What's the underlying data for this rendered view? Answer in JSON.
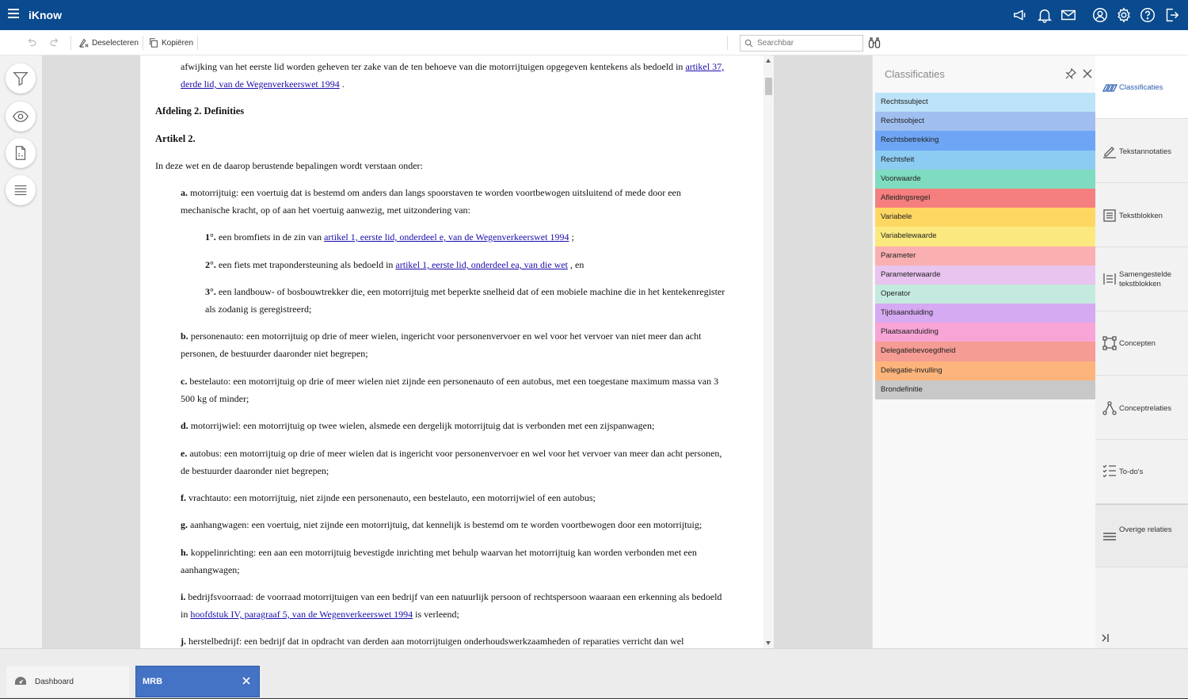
{
  "app": {
    "title": "iKnow"
  },
  "toolbar": {
    "deselect_label": "Deselecteren",
    "copy_label": "Kopiëren",
    "search_placeholder": "Searchbar"
  },
  "document": {
    "p0_text": "afwijking van het eerste lid worden geheven ter zake van de ten behoeve van die motorrijtuigen opgegeven kentekens als bedoeld in ",
    "p0_link1": "artikel 37,",
    "p0_link2": "derde lid, van de Wegenverkeerswet 1994",
    "p0_end": " .",
    "h_afdeling": "Afdeling 2. Definities",
    "h_artikel": "Artikel 2.",
    "intro": "In deze wet en de daarop berustende bepalingen wordt verstaan onder:",
    "a_letter": "a.",
    "a_text1": " motorrijtuig: een voertuig dat is bestemd om anders dan langs spoorstaven te worden voortbewogen uitsluitend of mede door een",
    "a_text2": "mechanische kracht, op of aan het voertuig aanwezig, met uitzondering van:",
    "a1_num": "1°.",
    "a1_text": " een bromfiets in de zin van ",
    "a1_link": "artikel 1, eerste lid, onderdeel e, van de Wegenverkeerswet 1994",
    "a1_end": " ;",
    "a2_num": "2°.",
    "a2_text": " een fiets met trapondersteuning als bedoeld in ",
    "a2_link": "artikel 1, eerste lid, onderdeel ea, van die wet",
    "a2_end": " , en",
    "a3_num": "3°.",
    "a3_text1": " een landbouw- of bosbouwtrekker die, een motorrijtuig met beperkte snelheid dat of een mobiele machine die in het kentekenregister",
    "a3_text2": "als zodanig is geregistreerd;",
    "b_letter": "b.",
    "b_text1": " personenauto: een motorrijtuig op drie of meer wielen, ingericht voor personenvervoer en wel voor het vervoer van niet meer dan acht",
    "b_text2": "personen, de bestuurder daaronder niet begrepen;",
    "c_letter": "c.",
    "c_text1": " bestelauto: een motorrijtuig op drie of meer wielen niet zijnde een personenauto of een autobus, met een toegestane maximum massa van 3",
    "c_text2": "500 kg of minder;",
    "d_letter": "d.",
    "d_text": " motorrijwiel: een motorrijtuig op twee wielen, alsmede een dergelijk motorrijtuig dat is verbonden met een zijspanwagen;",
    "e_letter": "e.",
    "e_text1": " autobus: een motorrijtuig op drie of meer wielen dat is ingericht voor personenvervoer en wel voor het vervoer van meer dan acht personen,",
    "e_text2": "de bestuurder daaronder niet begrepen;",
    "f_letter": "f.",
    "f_text": " vrachtauto: een motorrijtuig, niet zijnde een personenauto, een bestelauto, een motorrijwiel of een autobus;",
    "g_letter": "g.",
    "g_text": " aanhangwagen: een voertuig, niet zijnde een motorrijtuig, dat kennelijk is bestemd om te worden voortbewogen door een motorrijtuig;",
    "h_letter": "h.",
    "h_text1": " koppelinrichting: een aan een motorrijtuig bevestigde inrichting met behulp waarvan het motorrijtuig kan worden verbonden met een",
    "h_text2": "aanhangwagen;",
    "i_letter": "i.",
    "i_text1": " bedrijfsvoorraad: de voorraad motorrijtuigen van een bedrijf van een natuurlijk persoon of rechtspersoon waaraan een erkenning als bedoeld",
    "i_text2": "in ",
    "i_link": "hoofdstuk IV, paragraaf 5, van de Wegenverkeerswet 1994",
    "i_end": " is verleend;",
    "j_letter": "j.",
    "j_text": " herstelbedrijf: een bedrijf dat in opdracht van derden aan motorrijtuigen onderhoudswerkzaamheden of reparaties verricht dan wel"
  },
  "classificaties": {
    "title": "Classificaties",
    "items": [
      {
        "label": "Rechtssubject",
        "color": "#bde3f8"
      },
      {
        "label": "Rechtsobject",
        "color": "#a0bff0"
      },
      {
        "label": "Rechtsbetrekking",
        "color": "#6ea6f5"
      },
      {
        "label": "Rechtsfeit",
        "color": "#8cccf2"
      },
      {
        "label": "Voorwaarde",
        "color": "#7fdcc0"
      },
      {
        "label": "Afleidingsregel",
        "color": "#f57f7f"
      },
      {
        "label": "Variabele",
        "color": "#fed763"
      },
      {
        "label": "Variabelewaarde",
        "color": "#fbe97f"
      },
      {
        "label": "Parameter",
        "color": "#fab0b0"
      },
      {
        "label": "Parameterwaarde",
        "color": "#e8c4ee"
      },
      {
        "label": "Operator",
        "color": "#c4eadf"
      },
      {
        "label": "Tijdsaanduiding",
        "color": "#d6aaf2"
      },
      {
        "label": "Plaatsaanduiding",
        "color": "#f9a4d6"
      },
      {
        "label": "Delegatiebevoegdheid",
        "color": "#f59c94"
      },
      {
        "label": "Delegatie-invulling",
        "color": "#fdb47c"
      },
      {
        "label": "Brondefinitie",
        "color": "#c8c8c8"
      }
    ]
  },
  "right_tabs": [
    {
      "label": "Classificaties"
    },
    {
      "label": "Tekstannotaties"
    },
    {
      "label": "Tekstblokken"
    },
    {
      "label": "Samengestelde tekstblokken"
    },
    {
      "label": "Concepten"
    },
    {
      "label": "Conceptrelaties"
    },
    {
      "label": "To-do's"
    },
    {
      "label": "Overige relaties"
    }
  ],
  "bottom_tabs": {
    "dashboard_label": "Dashboard",
    "mrb_label": "MRB"
  },
  "colors": {
    "header_bg": "#0a4a8e",
    "active_tab_bg": "#4472c4",
    "link": "#1a0dab"
  }
}
